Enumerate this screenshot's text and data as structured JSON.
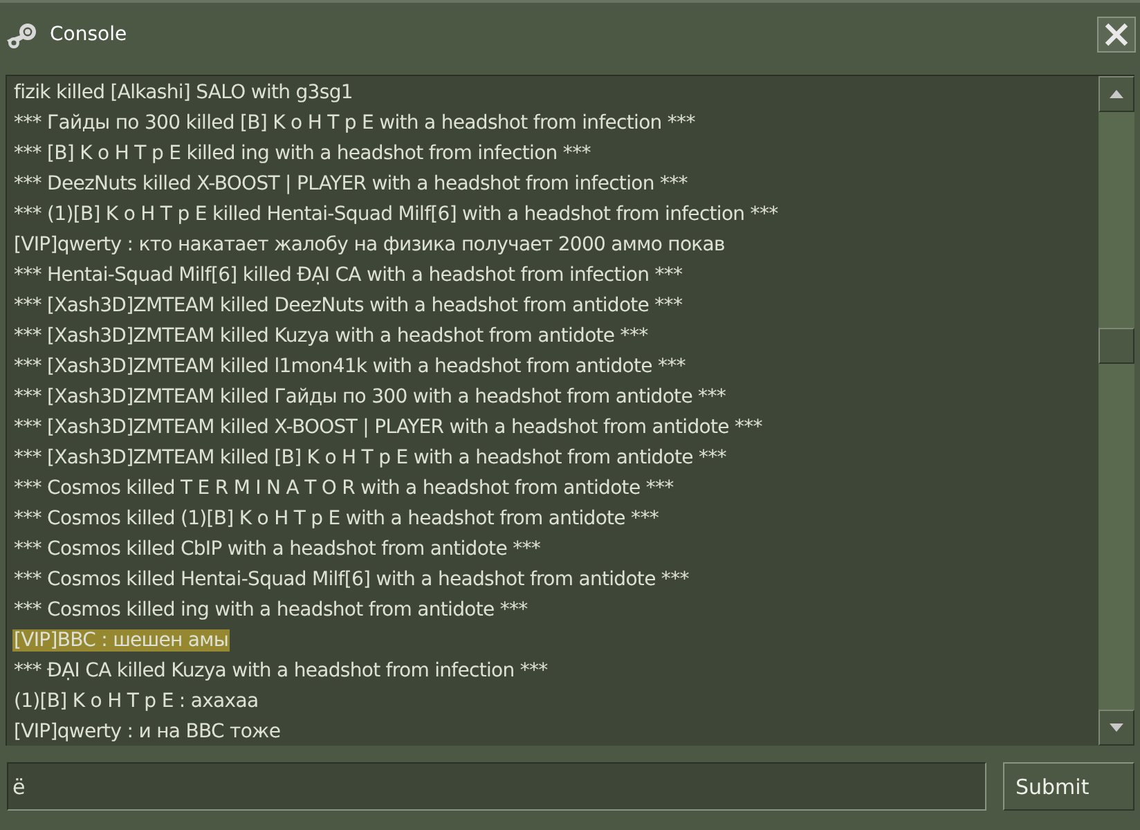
{
  "window": {
    "title": "Console"
  },
  "console": {
    "lines": [
      {
        "text": "fizik killed [Alkashi] SALO with g3sg1",
        "selected": false
      },
      {
        "text": "*** Гайды по 300 killed [B] K o H T p E with a headshot from infection ***",
        "selected": false
      },
      {
        "text": "*** [B] K o H T p E killed ing with a headshot from infection ***",
        "selected": false
      },
      {
        "text": "*** DeezNuts killed X-BOOST | PLAYER with a headshot from infection ***",
        "selected": false
      },
      {
        "text": "*** (1)[B] K o H T p E killed Hentai-Squad Milf[6] with a headshot from infection ***",
        "selected": false
      },
      {
        "text": "[VIP]qwerty : кто накатает жалобу на физика получает 2000 аммо покав",
        "selected": false
      },
      {
        "text": "*** Hentai-Squad Milf[6] killed ĐẠI CA with a headshot from infection ***",
        "selected": false
      },
      {
        "text": "*** [Xash3D]ZMTEAM killed DeezNuts with a headshot from antidote ***",
        "selected": false
      },
      {
        "text": "*** [Xash3D]ZMTEAM killed Kuzya with a headshot from antidote ***",
        "selected": false
      },
      {
        "text": "*** [Xash3D]ZMTEAM killed l1mon41k with a headshot from antidote ***",
        "selected": false
      },
      {
        "text": "*** [Xash3D]ZMTEAM killed Гайды по 300 with a headshot from antidote ***",
        "selected": false
      },
      {
        "text": "*** [Xash3D]ZMTEAM killed X-BOOST | PLAYER with a headshot from antidote ***",
        "selected": false
      },
      {
        "text": "*** [Xash3D]ZMTEAM killed [B] K o H T p E with a headshot from antidote ***",
        "selected": false
      },
      {
        "text": "*** Cosmos killed T E R M I N A T O R with a headshot from antidote ***",
        "selected": false
      },
      {
        "text": "*** Cosmos killed (1)[B] K o H T p E with a headshot from antidote ***",
        "selected": false
      },
      {
        "text": "*** Cosmos killed CbIP with a headshot from antidote ***",
        "selected": false
      },
      {
        "text": "*** Cosmos killed Hentai-Squad Milf[6] with a headshot from antidote ***",
        "selected": false
      },
      {
        "text": "*** Cosmos killed ing with a headshot from antidote ***",
        "selected": false
      },
      {
        "text": "[VIP]BBC : шешен амы",
        "selected": true
      },
      {
        "text": "*** ĐẠI CA killed Kuzya with a headshot from infection ***",
        "selected": false
      },
      {
        "text": "(1)[B] K o H T p E : ахахаа",
        "selected": false
      },
      {
        "text": "[VIP]qwerty : и на BBC тоже",
        "selected": false
      }
    ]
  },
  "input": {
    "value": "ё"
  },
  "buttons": [
    "Submit"
  ]
}
